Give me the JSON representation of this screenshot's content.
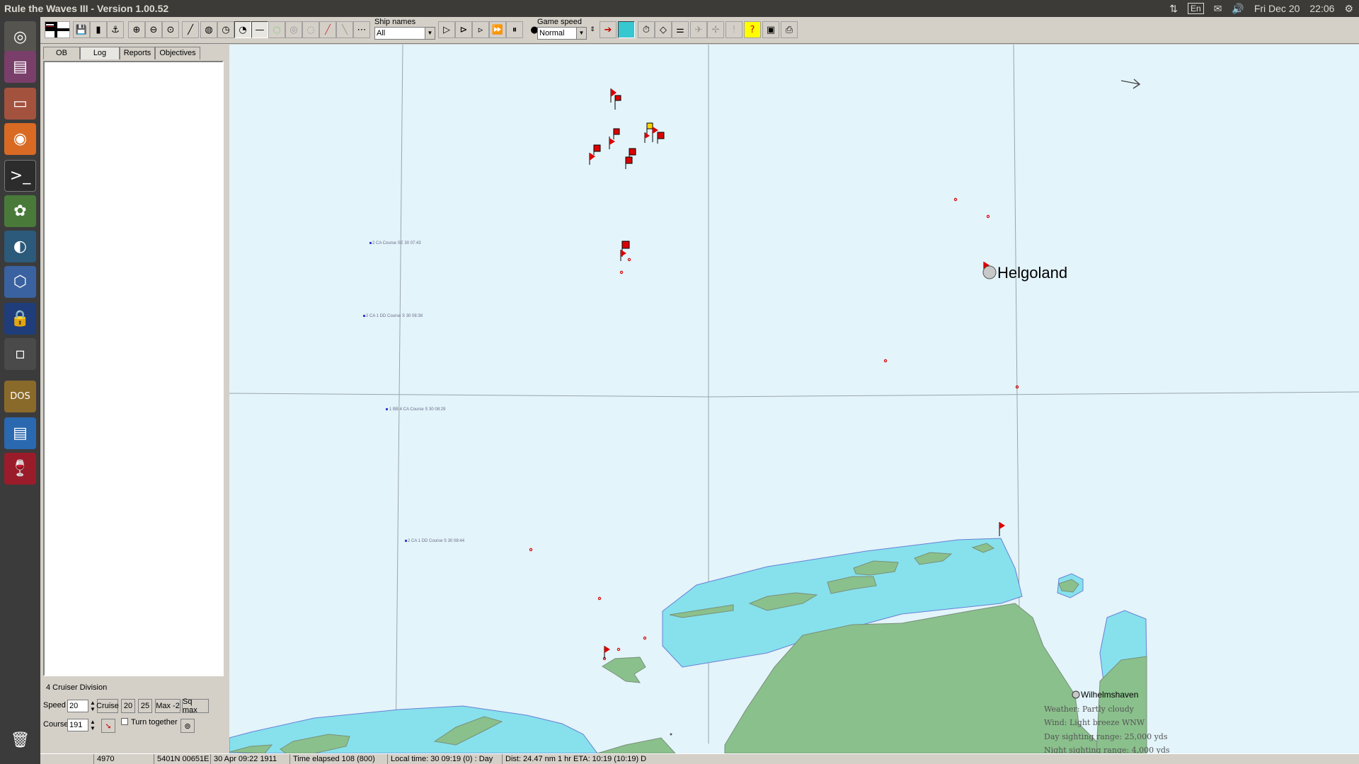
{
  "window": {
    "title": "Rule the Waves III - Version 1.00.52"
  },
  "tray": {
    "lang": "En",
    "date": "Fri Dec 20",
    "time": "22:06"
  },
  "launcher": {
    "items": [
      "dash-icon",
      "files-icon",
      "archive-icon",
      "firefox-icon",
      "terminal-icon",
      "colors-icon",
      "steam-icon",
      "virtualbox-icon",
      "lock-icon",
      "window-icon",
      "dosbox-icon",
      "writer-icon",
      "wine-icon",
      "trash-icon"
    ]
  },
  "toolbar": {
    "ship_names_label": "Ship names",
    "ship_names_value": "All",
    "game_speed_label": "Game speed",
    "game_speed_value": "Normal"
  },
  "left_panel": {
    "tabs": [
      "OB",
      "Log",
      "Reports",
      "Objectives"
    ],
    "active_tab": "Log",
    "division_name": "4 Cruiser Division",
    "speed_label": "Speed",
    "speed_value": "20",
    "speed_buttons": [
      "Cruise",
      "20",
      "25",
      "Max -2",
      "Sq max"
    ],
    "course_label": "Course",
    "course_value": "191",
    "turn_together_label": "Turn together"
  },
  "map": {
    "place_labels": {
      "helgoland": "Helgoland",
      "wilhelmshaven": "Wilhelmshaven"
    },
    "contact_labels": [
      "2 CA Course SE 30 07:43",
      "2 CA 1 DD Course S 30 08:38",
      "1 BB 4 CA Course S 30 08:29",
      "2 CA 1 DD Course S 30 08:44"
    ],
    "weather": {
      "line1": "Weather: Partly cloudy",
      "line2": "Wind: Light breeze  WNW",
      "line3": "Day sighting range: 25,000 yds",
      "line4": "Night sighting range: 4,000 yds"
    }
  },
  "status_bar": {
    "cell1": "4970",
    "cell2": "5401N 00651E",
    "cell3": "30 Apr 09:22 1911",
    "cell4": "Time elapsed 108 (800)",
    "cell5": "Local time: 30 09:19 (0) : Day",
    "cell6": "Dist: 24.47 nm 1 hr ETA: 10:19 (10:19) D"
  }
}
